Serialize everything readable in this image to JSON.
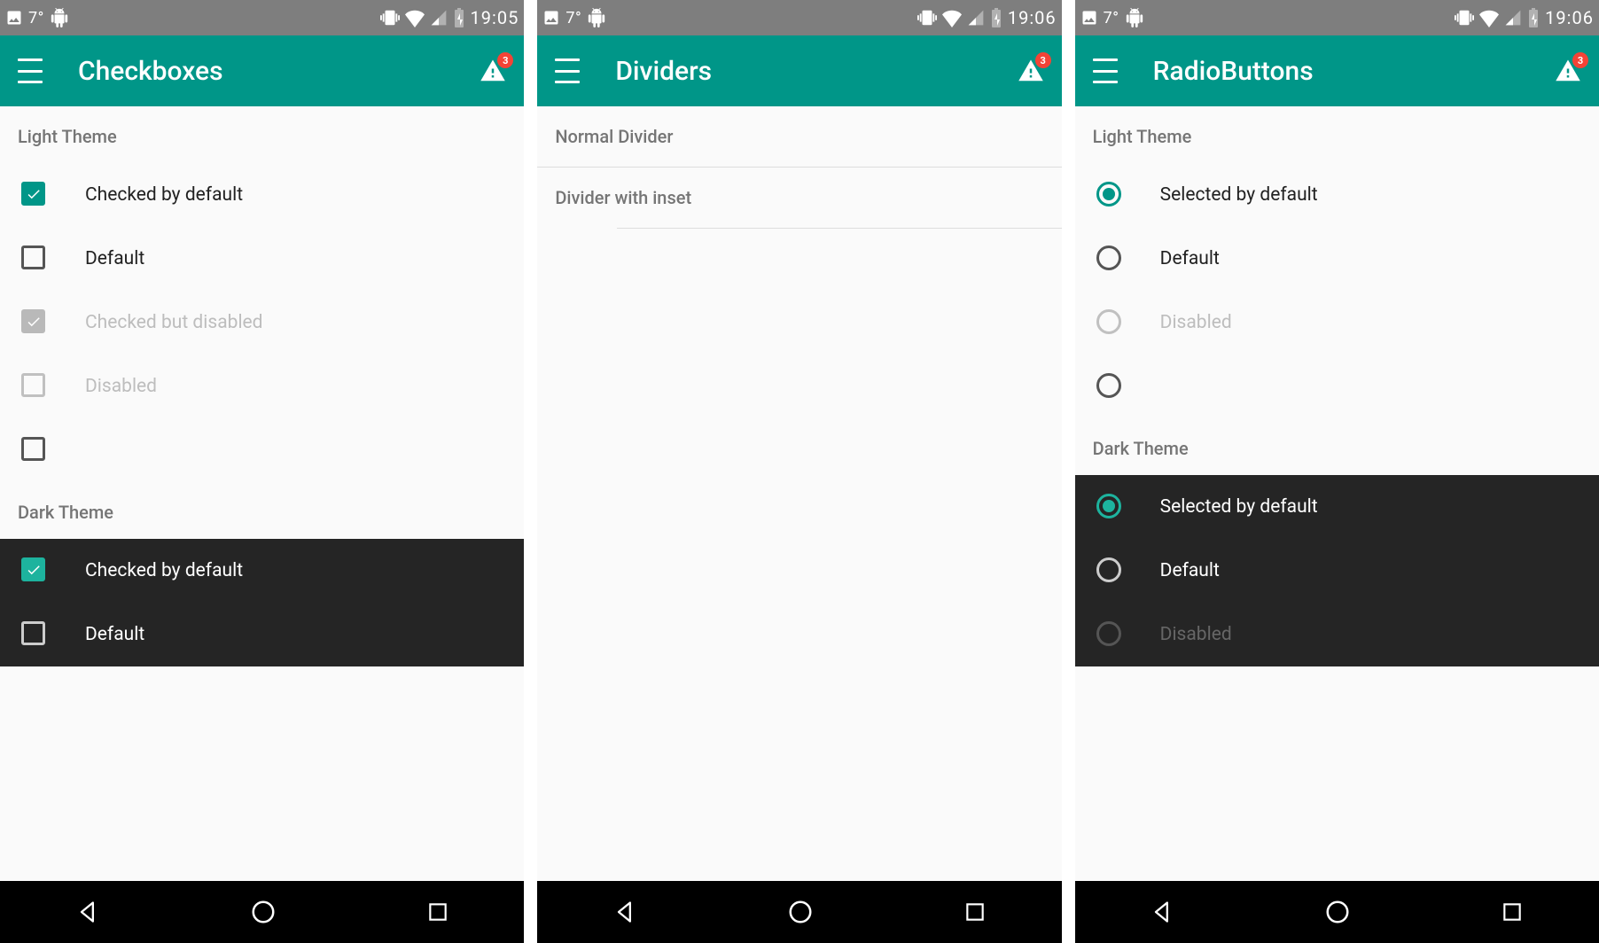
{
  "status": {
    "temperature": "7°",
    "badge": "3"
  },
  "screens": [
    {
      "clock": "19:05",
      "title": "Checkboxes",
      "light_header": "Light Theme",
      "dark_header": "Dark Theme",
      "light_items": [
        {
          "label": "Checked by default"
        },
        {
          "label": "Default"
        },
        {
          "label": "Checked but disabled"
        },
        {
          "label": "Disabled"
        },
        {
          "label": ""
        }
      ],
      "dark_items": [
        {
          "label": "Checked by default"
        },
        {
          "label": "Default"
        }
      ]
    },
    {
      "clock": "19:06",
      "title": "Dividers",
      "section1": "Normal Divider",
      "section2": "Divider with inset"
    },
    {
      "clock": "19:06",
      "title": "RadioButtons",
      "light_header": "Light Theme",
      "dark_header": "Dark Theme",
      "light_items": [
        {
          "label": "Selected by default"
        },
        {
          "label": "Default"
        },
        {
          "label": "Disabled"
        },
        {
          "label": ""
        }
      ],
      "dark_items": [
        {
          "label": "Selected by default"
        },
        {
          "label": "Default"
        },
        {
          "label": "Disabled"
        }
      ]
    }
  ]
}
